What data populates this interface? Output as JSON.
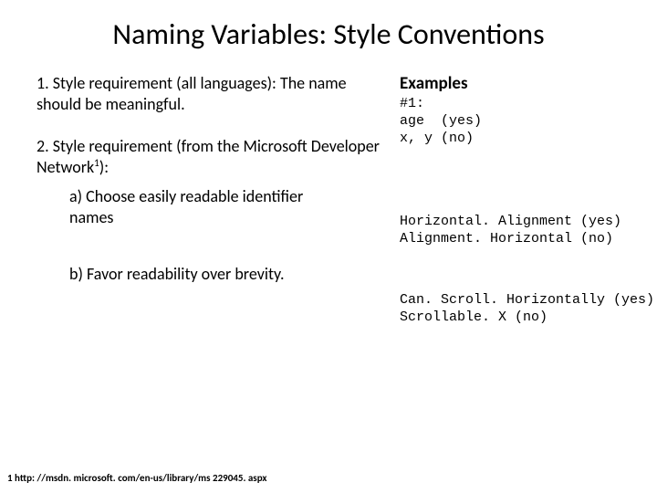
{
  "title": "Naming Variables: Style Conventions",
  "left": {
    "item1_num": "1. ",
    "item1_text": "Style requirement (all languages): The name should be meaningful.",
    "item2_num": "2. ",
    "item2_text_before_sup": "Style requirement (from the Microsoft Developer Network",
    "item2_sup": "1",
    "item2_text_after_sup": "):",
    "sub_a_label": "a) ",
    "sub_a_text": "Choose easily readable identifier names",
    "sub_b_label": "b) ",
    "sub_b_text": "Favor readability over brevity."
  },
  "right": {
    "heading": "Examples",
    "ex1": "#1:\nage  (yes)\nx, y (no)",
    "ex2": "Horizontal. Alignment (yes)\nAlignment. Horizontal (no)",
    "ex3": "Can. Scroll. Horizontally (yes)\nScrollable. X (no)"
  },
  "footnote": "1 http: //msdn. microsoft. com/en-us/library/ms 229045. aspx"
}
